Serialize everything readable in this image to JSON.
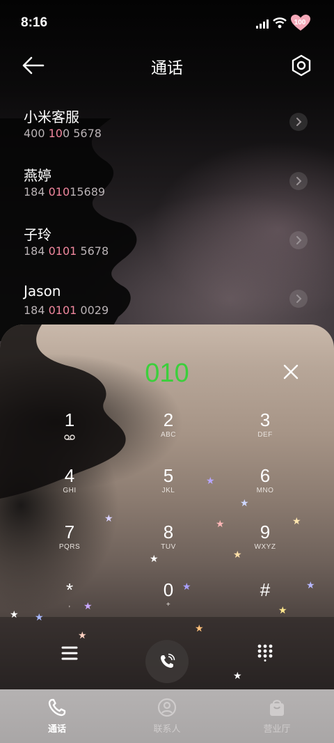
{
  "status_bar": {
    "time": "8:16",
    "battery": "100"
  },
  "header": {
    "title": "通话"
  },
  "contacts": [
    {
      "name": "小米客服",
      "num_a": "400 ",
      "num_hl": "10",
      "num_b": "0 5678"
    },
    {
      "name": "燕婷",
      "num_a": "184 ",
      "num_hl": "010",
      "num_b": "15689"
    },
    {
      "name": "子玲",
      "num_a": "184 ",
      "num_hl": "0101",
      "num_b": " 5678"
    },
    {
      "name": "Jason",
      "num_a": "184 ",
      "num_hl": "0101",
      "num_b": " 0029"
    }
  ],
  "dialer": {
    "input": "010",
    "keys": [
      {
        "digit": "1",
        "letters": ""
      },
      {
        "digit": "2",
        "letters": "ABC"
      },
      {
        "digit": "3",
        "letters": "DEF"
      },
      {
        "digit": "4",
        "letters": "GHI"
      },
      {
        "digit": "5",
        "letters": "JKL"
      },
      {
        "digit": "6",
        "letters": "MNO"
      },
      {
        "digit": "7",
        "letters": "PQRS"
      },
      {
        "digit": "8",
        "letters": "TUV"
      },
      {
        "digit": "9",
        "letters": "WXYZ"
      },
      {
        "digit": "*",
        "letters": ","
      },
      {
        "digit": "0",
        "letters": "+"
      },
      {
        "digit": "#",
        "letters": ""
      }
    ]
  },
  "tabs": [
    {
      "label": "通话",
      "icon": "phone-icon",
      "active": true
    },
    {
      "label": "联系人",
      "icon": "person-icon",
      "active": false
    },
    {
      "label": "营业厅",
      "icon": "bag-icon",
      "active": false
    }
  ],
  "colors": {
    "input_digits": "#3ccf3c",
    "number_highlight": "#f0879e"
  }
}
